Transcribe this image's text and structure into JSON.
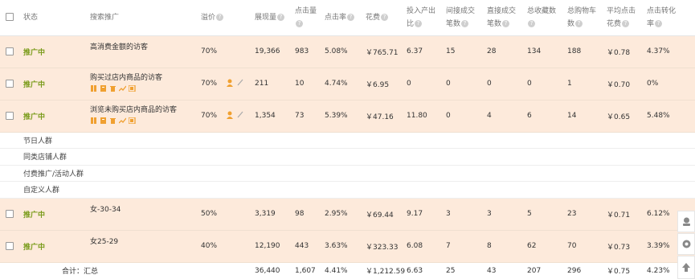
{
  "header": {
    "select_all": "",
    "status": "状态",
    "name": "搜索推广",
    "premium": "溢价",
    "impressions": "展现量",
    "clicks": "点击量",
    "ctr": "点击率",
    "cost": "花费",
    "roi_l1": "投入产出",
    "roi_l2": "比",
    "indirect_l1": "间接成交",
    "indirect_l2": "笔数",
    "direct_l1": "直接成交",
    "direct_l2": "笔数",
    "fav_l1": "总收藏数",
    "fav_l2": "",
    "cart_l1": "总购物车",
    "cart_l2": "数",
    "cpc_l1": "平均点击",
    "cpc_l2": "花费",
    "cvr_l1": "点击转化",
    "cvr_l2": "率"
  },
  "rows": [
    {
      "status": "推广中",
      "name": "高消费金额的访客",
      "tools": false,
      "premium": "70%",
      "impressions": "19,366",
      "clicks": "983",
      "ctr": "5.08%",
      "cost": "￥765.71",
      "roi": "6.37",
      "indirect": "15",
      "direct": "28",
      "fav": "134",
      "cart": "188",
      "cpc": "￥0.78",
      "cvr": "4.37%"
    },
    {
      "status": "推广中",
      "name": "购买过店内商品的访客",
      "tools": true,
      "premium": "70%",
      "impressions": "211",
      "clicks": "10",
      "ctr": "4.74%",
      "cost": "￥6.95",
      "roi": "0",
      "indirect": "0",
      "direct": "0",
      "fav": "0",
      "cart": "1",
      "cpc": "￥0.70",
      "cvr": "0%"
    },
    {
      "status": "推广中",
      "name": "浏览未购买店内商品的访客",
      "tools": true,
      "premium": "70%",
      "impressions": "1,354",
      "clicks": "73",
      "ctr": "5.39%",
      "cost": "￥47.16",
      "roi": "11.80",
      "indirect": "0",
      "direct": "4",
      "fav": "6",
      "cart": "14",
      "cpc": "￥0.65",
      "cvr": "5.48%"
    }
  ],
  "segments": [
    "节日人群",
    "同类店铺人群",
    "付费推广/活动人群",
    "自定义人群"
  ],
  "rows2": [
    {
      "status": "推广中",
      "name": "女-30-34",
      "premium": "50%",
      "impressions": "3,319",
      "clicks": "98",
      "ctr": "2.95%",
      "cost": "￥69.44",
      "roi": "9.17",
      "indirect": "3",
      "direct": "3",
      "fav": "5",
      "cart": "23",
      "cpc": "￥0.71",
      "cvr": "6.12%"
    },
    {
      "status": "推广中",
      "name": "女25-29",
      "premium": "40%",
      "impressions": "12,190",
      "clicks": "443",
      "ctr": "3.63%",
      "cost": "￥323.33",
      "roi": "6.08",
      "indirect": "7",
      "direct": "8",
      "fav": "62",
      "cart": "70",
      "cpc": "￥0.73",
      "cvr": "3.39%"
    }
  ],
  "total": {
    "label": "合计：汇总",
    "impressions": "36,440",
    "clicks": "1,607",
    "ctr": "4.41%",
    "cost": "￥1,212.59",
    "roi": "6.63",
    "indirect": "25",
    "direct": "43",
    "fav": "207",
    "cart": "296",
    "cpc": "￥0.75",
    "cvr": "4.23%"
  },
  "colors": {
    "row_bg": "#fdeadb",
    "status_green": "#7a9b1a",
    "tool_orange": "#f0a030"
  },
  "icons": [
    "pause-icon",
    "edit-icon",
    "delete-icon",
    "trend-icon",
    "report-icon",
    "person-icon",
    "pencil-icon",
    "help-icon",
    "service-icon",
    "feedback-icon",
    "back-to-top-icon"
  ]
}
